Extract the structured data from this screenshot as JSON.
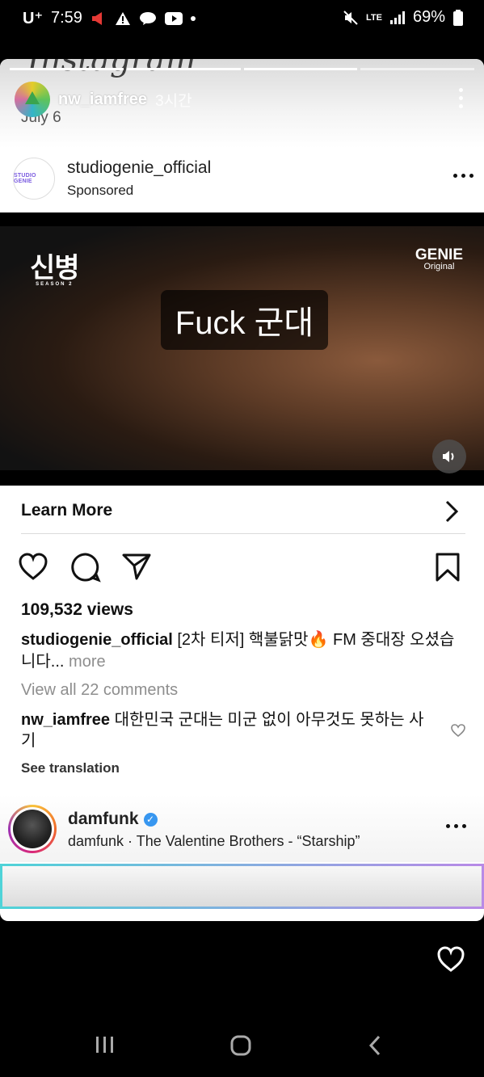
{
  "status_bar": {
    "carrier": "U⁺",
    "time": "7:59",
    "network": "LTE",
    "battery": "69%"
  },
  "background": {
    "ghost_title": "Instagram",
    "ghost_date": "July 6"
  },
  "story": {
    "username": "nw_iamfree",
    "time": "3시간"
  },
  "post": {
    "avatar_text": "STUDIO GENIE",
    "username": "studiogenie_official",
    "sponsored": "Sponsored",
    "video": {
      "logo_left": "신병",
      "logo_left_sub": "SEASON 2",
      "logo_right": "GENIE",
      "logo_right_sub": "Original",
      "subtitle": "Fuck 군대"
    },
    "learn_more": "Learn More",
    "views": "109,532 views",
    "caption_user": "studiogenie_official",
    "caption_text": "[2차 티저] 핵불닭맛🔥 FM 중대장 오셨습니다...",
    "caption_more": "more",
    "view_all_comments": "View all 22 comments",
    "comment_user": "nw_iamfree",
    "comment_text": "대한민국 군대는 미군 없이 아무것도 못하는 사기",
    "see_translation": "See translation"
  },
  "next_post": {
    "username": "damfunk",
    "subtitle": "damfunk · The Valentine Brothers - “Starship”"
  },
  "icons": {
    "heart": "heart-icon",
    "comment": "comment-icon",
    "share": "share-icon",
    "bookmark": "bookmark-icon",
    "chevron": "chevron-right-icon",
    "speaker": "speaker-icon"
  },
  "colors": {
    "verified": "#3897f0",
    "muted_text": "#8e8e8e"
  }
}
